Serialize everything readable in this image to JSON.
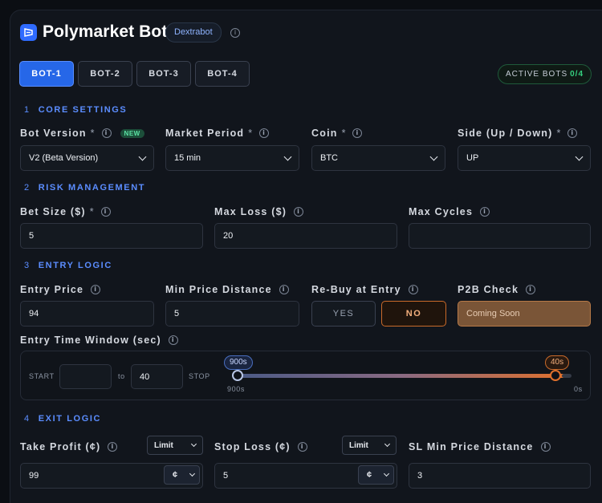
{
  "header": {
    "title": "Polymarket Bot",
    "badge": "Dextrabot"
  },
  "tabs": [
    "BOT-1",
    "BOT-2",
    "BOT-3",
    "BOT-4"
  ],
  "active_tab": 0,
  "active_bots": {
    "label": "ACTIVE BOTS",
    "count": "0/4"
  },
  "core": {
    "num": "1",
    "title": "CORE SETTINGS",
    "bot_version": {
      "label": "Bot Version",
      "required": "*",
      "new_badge": "NEW",
      "value": "V2 (Beta Version)"
    },
    "market_period": {
      "label": "Market Period",
      "required": "*",
      "value": "15 min"
    },
    "coin": {
      "label": "Coin",
      "required": "*",
      "value": "BTC"
    },
    "side": {
      "label": "Side (Up / Down)",
      "required": "*",
      "value": "UP"
    }
  },
  "risk": {
    "num": "2",
    "title": "RISK MANAGEMENT",
    "bet_size": {
      "label": "Bet Size ($)",
      "required": "*",
      "value": "5"
    },
    "max_loss": {
      "label": "Max Loss ($)",
      "value": "20"
    },
    "max_cycles": {
      "label": "Max Cycles",
      "value": ""
    }
  },
  "entry": {
    "num": "3",
    "title": "ENTRY LOGIC",
    "entry_price": {
      "label": "Entry Price",
      "value": "94"
    },
    "min_price_distance": {
      "label": "Min Price Distance",
      "value": "5"
    },
    "rebuy": {
      "label": "Re-Buy at Entry",
      "yes": "YES",
      "no": "NO",
      "selected": "NO"
    },
    "p2b": {
      "label": "P2B Check",
      "value": "Coming Soon"
    },
    "window": {
      "label": "Entry Time Window (sec)",
      "start_label": "START",
      "start_value": "",
      "to_label": "to",
      "stop_value": "40",
      "stop_label": "STOP",
      "start_pill": "900s",
      "end_pill": "40s",
      "min_label": "900s",
      "max_label": "0s"
    }
  },
  "exit": {
    "num": "4",
    "title": "EXIT LOGIC",
    "take_profit": {
      "label": "Take Profit (¢)",
      "mode": "Limit",
      "value": "99",
      "unit": "¢"
    },
    "stop_loss": {
      "label": "Stop Loss (¢)",
      "mode": "Limit",
      "value": "5",
      "unit": "¢"
    },
    "sl_min_distance": {
      "label": "SL Min Price Distance",
      "value": "3"
    }
  },
  "colors": {
    "accent": "#2667e8",
    "section": "#5b8dff",
    "orange": "#e0702c",
    "green": "#35d07f"
  }
}
